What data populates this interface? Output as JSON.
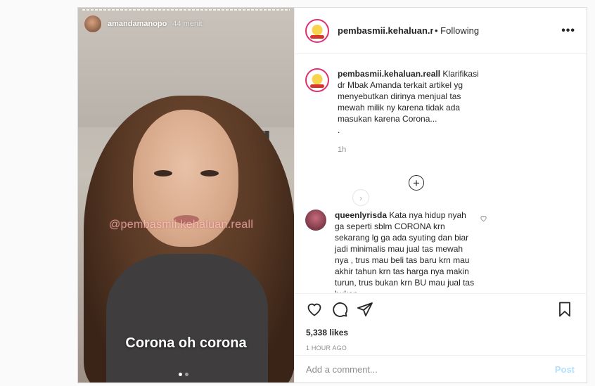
{
  "story": {
    "username": "amandamanopo",
    "time": "44 menit",
    "watermark": "@pembasmii.kehaluan.reall",
    "caption": "Corona oh corona"
  },
  "header": {
    "username": "pembasmii.kehaluan.re",
    "follow_status": "• Following",
    "more_label": "•••"
  },
  "caption": {
    "username": "pembasmii.kehaluan.reall",
    "text": "Klarifikasi dr Mbak Amanda terkait artikel yg menyebutkan dirinya menjual tas mewah milik ny karena tidak ada masukan karena Corona...",
    "dot": ".",
    "time": "1h"
  },
  "load_more_icon": "plus-circle-icon",
  "comment": {
    "username": "queenlyrisda",
    "text": "Kata nya hidup nyah ga seperti sblm CORONA krn sekarang lg ga ada syuting dan biar jadi minimalis mau jual tas mewah nya , trus mau beli tas baru krn mau akhir tahun krn tas harga nya makin turun, trus bukan krn BU mau jual tas bukan"
  },
  "actions": {
    "likes": "5,338 likes",
    "ago": "1 HOUR AGO"
  },
  "add_comment": {
    "placeholder": "Add a comment...",
    "post_label": "Post"
  }
}
